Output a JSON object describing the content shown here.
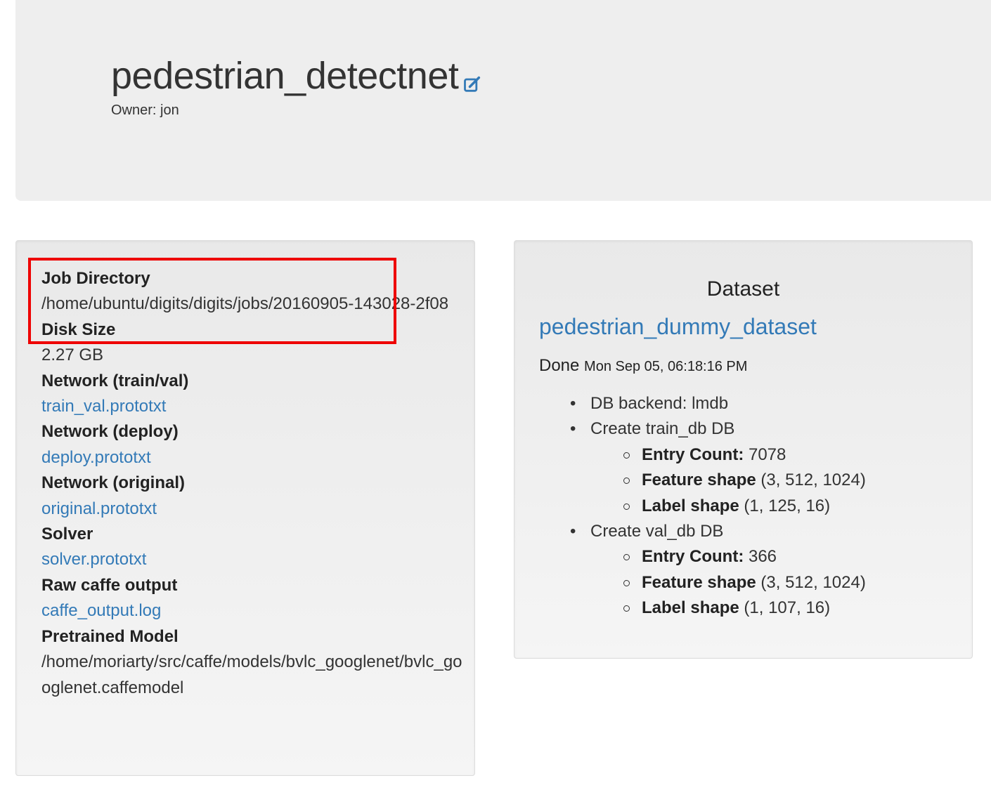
{
  "header": {
    "title": "pedestrian_detectnet",
    "edit_icon": "edit-icon",
    "owner": "Owner: jon"
  },
  "job_info": [
    {
      "label": "Job Directory",
      "value": "/home/ubuntu/digits/digits/jobs/20160905-143028-2f08",
      "is_link": false
    },
    {
      "label": "Disk Size",
      "value": "2.27 GB",
      "is_link": false
    },
    {
      "label": "Network (train/val)",
      "value": "train_val.prototxt",
      "is_link": true
    },
    {
      "label": "Network (deploy)",
      "value": "deploy.prototxt",
      "is_link": true
    },
    {
      "label": "Network (original)",
      "value": "original.prototxt",
      "is_link": true
    },
    {
      "label": "Solver",
      "value": "solver.prototxt",
      "is_link": true
    },
    {
      "label": "Raw caffe output",
      "value": "caffe_output.log",
      "is_link": true
    },
    {
      "label": "Pretrained Model",
      "value": "/home/moriarty/src/caffe/models/bvlc_googlenet/bvlc_googlenet.caffemodel",
      "is_link": false
    }
  ],
  "dataset": {
    "heading": "Dataset",
    "name": "pedestrian_dummy_dataset",
    "status": "Done",
    "timestamp": "Mon Sep 05, 06:18:16 PM",
    "backend": "DB backend: lmdb",
    "dbs": [
      {
        "title": "Create train_db DB",
        "entry_label": "Entry Count:",
        "entry_value": "7078",
        "feature_label": "Feature shape",
        "feature_value": "(3, 512, 1024)",
        "label_label": "Label shape",
        "label_value": "(1, 125, 16)"
      },
      {
        "title": "Create val_db DB",
        "entry_label": "Entry Count:",
        "entry_value": "366",
        "feature_label": "Feature shape",
        "feature_value": "(3, 512, 1024)",
        "label_label": "Label shape",
        "label_value": "(1, 107, 16)"
      }
    ]
  },
  "colors": {
    "link": "#337ab7",
    "highlight": "#ee0000",
    "jumbotron": "#eeeeee"
  }
}
